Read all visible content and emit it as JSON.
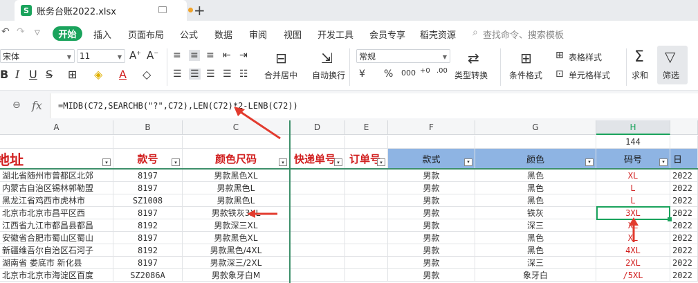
{
  "titlebar": {
    "tab_title": "账务台账2022.xlsx",
    "logo": "S"
  },
  "menu": {
    "start": "开始",
    "items": [
      "插入",
      "页面布局",
      "公式",
      "数据",
      "审阅",
      "视图",
      "开发工具",
      "会员专享",
      "稻壳资源"
    ],
    "search": "查找命令、搜索模板"
  },
  "ribbon": {
    "font_name": "宋体",
    "font_size": "11",
    "number_format": "常规",
    "merge_label": "合并居中",
    "wrap_label": "自动换行",
    "type_convert_label": "类型转换",
    "cond_format_label": "条件格式",
    "table_style_label": "表格样式",
    "cell_style_label": "单元格样式",
    "sum_label": "求和",
    "filter_label": "筛选"
  },
  "formula_bar": {
    "formula": "=MIDB(C72,SEARCHB(\"?\",C72),LEN(C72)*2-LENB(C72))"
  },
  "columns": [
    "A",
    "B",
    "C",
    "D",
    "E",
    "F",
    "G",
    "H",
    ""
  ],
  "summary_row": {
    "h": "144"
  },
  "header_row": {
    "a": "地址",
    "b": "款号",
    "c": "颜色尺码",
    "d": "快递单号",
    "e": "订单号",
    "f": "款式",
    "g": "颜色",
    "h": "码号",
    "i": "日"
  },
  "rows": [
    {
      "a": "湖北省随州市曾都区北郊",
      "b": "8197",
      "c": "男款黑色XL",
      "f": "男款",
      "g": "黑色",
      "h": "XL",
      "i": "2022"
    },
    {
      "a": "内蒙古自治区锡林郭勒盟",
      "b": "8197",
      "c": "男款黑色L",
      "f": "男款",
      "g": "黑色",
      "h": "L",
      "i": "2022"
    },
    {
      "a": "黑龙江省鸡西市虎林市",
      "b": "SZ1008",
      "c": "男款黑色L",
      "f": "男款",
      "g": "黑色",
      "h": "L",
      "i": "2022"
    },
    {
      "a": "北京市北京市昌平区西",
      "b": "8197",
      "c": "男款铁灰3XL",
      "f": "男款",
      "g": "铁灰",
      "h": "3XL",
      "i": "2022"
    },
    {
      "a": "江西省九江市都昌县都昌",
      "b": "8192",
      "c": "男款深三XL",
      "f": "男款",
      "g": "深三",
      "h": "XL",
      "i": "2022"
    },
    {
      "a": "安徽省合肥市蜀山区蜀山",
      "b": "8197",
      "c": "男款黑色XL",
      "f": "男款",
      "g": "黑色",
      "h": "XL",
      "i": "2022"
    },
    {
      "a": "新疆维吾尔自治区石河子",
      "b": "8192",
      "c": "男款黑色/4XL",
      "f": "男款",
      "g": "黑色",
      "h": "4XL",
      "i": "2022"
    },
    {
      "a": "湖南省 娄底市 新化县",
      "b": "8197",
      "c": "男款深三/2XL",
      "f": "男款",
      "g": "深三",
      "h": "2XL",
      "i": "2022"
    },
    {
      "a": "北京市北京市海淀区百度",
      "b": "SZ2086A",
      "c": "男款象牙白M",
      "f": "男款",
      "g": "象牙白",
      "h": "/5XL",
      "i": "2022"
    }
  ],
  "colors": {
    "accent": "#1aa35c",
    "header_red": "#d11f1f",
    "header_blue": "#8eb4e3",
    "arrow_red": "#e23b2e"
  }
}
